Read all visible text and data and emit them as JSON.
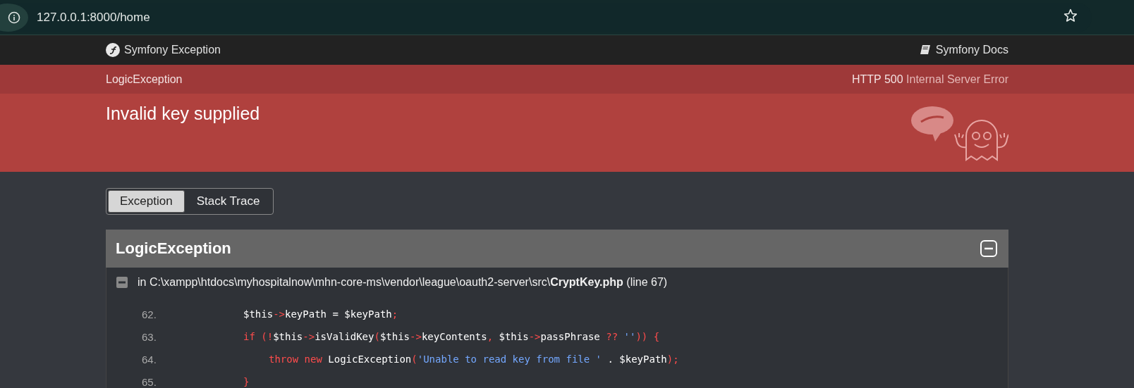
{
  "browser": {
    "url": "127.0.0.1:8000/home"
  },
  "header": {
    "brand": "Symfony Exception",
    "docs_link": "Symfony Docs"
  },
  "summary": {
    "exception_class": "LogicException",
    "status_code": "HTTP 500",
    "status_text": "Internal Server Error",
    "message": "Invalid key supplied"
  },
  "tabs": [
    {
      "label": "Exception",
      "selected": true
    },
    {
      "label": "Stack Trace",
      "selected": false
    }
  ],
  "exception": {
    "title": "LogicException",
    "expanded": true,
    "file": {
      "prefix": "in C:\\xampp\\htdocs\\myhospitalnow\\mhn-core-ms\\vendor\\league\\oauth2-server\\src\\",
      "name": "CryptKey.php",
      "line": "(line 67)"
    },
    "code": [
      {
        "number": "62.",
        "tokens": [
          {
            "kind": "plain",
            "text": "$this"
          },
          {
            "kind": "op",
            "text": "->"
          },
          {
            "kind": "plain",
            "text": "keyPath = $keyPath"
          },
          {
            "kind": "op",
            "text": ";"
          }
        ]
      },
      {
        "number": "63.",
        "tokens": [
          {
            "kind": "op",
            "text": "if (!"
          },
          {
            "kind": "plain",
            "text": "$this"
          },
          {
            "kind": "op",
            "text": "->"
          },
          {
            "kind": "plain",
            "text": "isValidKey"
          },
          {
            "kind": "op",
            "text": "("
          },
          {
            "kind": "plain",
            "text": "$this"
          },
          {
            "kind": "op",
            "text": "->"
          },
          {
            "kind": "plain",
            "text": "keyContents"
          },
          {
            "kind": "op",
            "text": ", "
          },
          {
            "kind": "plain",
            "text": "$this"
          },
          {
            "kind": "op",
            "text": "->"
          },
          {
            "kind": "plain",
            "text": "passPhrase "
          },
          {
            "kind": "op",
            "text": "?? "
          },
          {
            "kind": "string",
            "text": "''"
          },
          {
            "kind": "op",
            "text": ")) {"
          }
        ],
        "children": [
          {
            "number": "64.",
            "tokens": [
              {
                "kind": "op",
                "text": "throw new "
              },
              {
                "kind": "plain",
                "text": "LogicException"
              },
              {
                "kind": "op",
                "text": "("
              },
              {
                "kind": "string",
                "text": "'Unable to read key from file '"
              },
              {
                "kind": "plain",
                "text": " . $keyPath"
              },
              {
                "kind": "op",
                "text": ");"
              }
            ]
          }
        ]
      },
      {
        "number": "65.",
        "tokens": [
          {
            "kind": "op",
            "text": "}"
          }
        ]
      }
    ]
  }
}
